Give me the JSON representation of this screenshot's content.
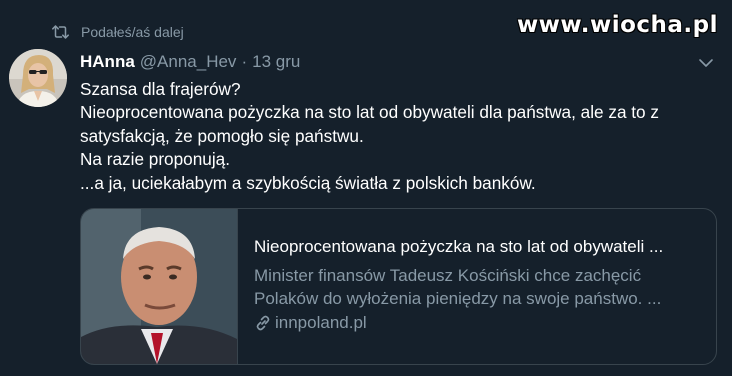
{
  "retweet": {
    "label": "Podałeś/aś dalej"
  },
  "watermark": {
    "text": "www.wiocha.pl"
  },
  "tweet": {
    "display_name": "HAnna",
    "handle": "@Anna_Hev",
    "separator": "·",
    "date": "13 gru",
    "lines": [
      "Szansa dla frajerów?",
      "Nieoprocentowana pożyczka na sto lat od obywateli dla państwa, ale za to z",
      "satysfakcją, że pomogło się państwu.",
      "Na razie proponują.",
      "...a ja, uciekałabym a szybkością światła z polskich banków."
    ]
  },
  "card": {
    "title": "Nieoprocentowana pożyczka na sto lat od obywateli ...",
    "description_lines": [
      "Minister finansów Tadeusz Kościński chce zachęcić",
      "Polaków do wyłożenia pieniędzy na swoje państwo. ..."
    ],
    "domain": "innpoland.pl"
  },
  "icons": {
    "retweet": "retweet-icon",
    "caret": "chevron-down-icon",
    "link": "link-icon"
  },
  "colors": {
    "background": "#15202b",
    "secondary_text": "#8899a6",
    "border": "#38444d"
  }
}
